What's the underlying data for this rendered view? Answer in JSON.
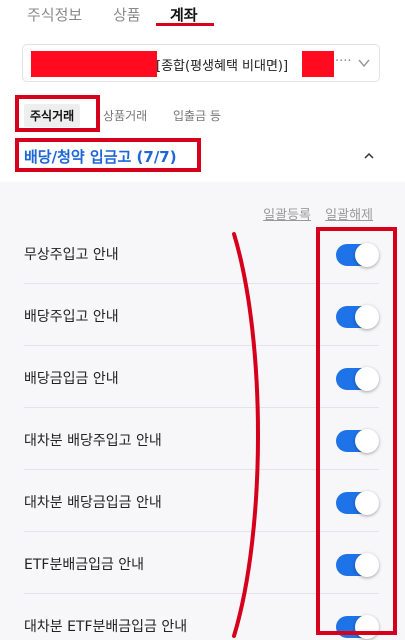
{
  "top_tabs": [
    "주식정보",
    "상품",
    "계좌"
  ],
  "account": {
    "name": "[종합(평생혜택 비대면)]",
    "ellipsis": "····"
  },
  "sub_tabs": [
    "주식거래",
    "상품거래",
    "입출금 등"
  ],
  "category": {
    "title": "배당/청약 입금고 (7/7)"
  },
  "bulk": {
    "register": "일괄등록",
    "release": "일괄해제"
  },
  "notifications": [
    {
      "label": "무상주입고 안내",
      "enabled": true
    },
    {
      "label": "배당주입고 안내",
      "enabled": true
    },
    {
      "label": "배당금입금 안내",
      "enabled": true
    },
    {
      "label": "대차분 배당주입고 안내",
      "enabled": true
    },
    {
      "label": "대차분 배당금입금 안내",
      "enabled": true
    },
    {
      "label": "ETF분배금입금 안내",
      "enabled": true
    },
    {
      "label": "대차분 ETF분배금입금 안내",
      "enabled": true
    }
  ],
  "colors": {
    "accent": "#1f73e8",
    "highlight": "#d6001c",
    "redaction": "#ff0a1f"
  }
}
